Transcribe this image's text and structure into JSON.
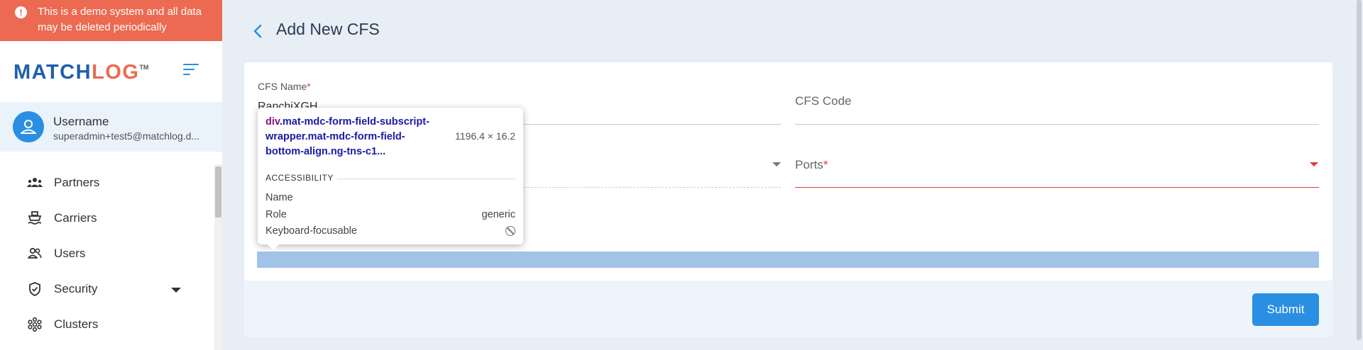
{
  "banner": {
    "text": "This is a demo system and all data may be deleted periodically",
    "icon": "alert-circle-icon"
  },
  "brand": {
    "part1": "MATCH",
    "part2": "LOG",
    "trademark": "TM",
    "color1": "#1f5fa8",
    "color2": "#ec6a51"
  },
  "user": {
    "name": "Username",
    "email": "superadmin+test5@matchlog.d..."
  },
  "nav": {
    "items": [
      {
        "label": "Partners",
        "icon": "partners-icon"
      },
      {
        "label": "Carriers",
        "icon": "ship-icon"
      },
      {
        "label": "Users",
        "icon": "users-icon"
      },
      {
        "label": "Security",
        "icon": "shield-icon",
        "expandable": true
      },
      {
        "label": "Clusters",
        "icon": "clusters-icon"
      }
    ]
  },
  "page": {
    "title": "Add New CFS"
  },
  "form": {
    "cfs_name": {
      "label": "CFS Name",
      "required_mark": "*",
      "value": "RanchiXGH"
    },
    "cfs_code": {
      "placeholder": "CFS Code"
    },
    "ports": {
      "label": "Ports",
      "required_mark": "*"
    },
    "submit_label": "Submit"
  },
  "devtools_tooltip": {
    "selector_tag": "div",
    "selector_rest": ".mat-mdc-form-field-subscript-wrapper.mat-mdc-form-field-bottom-align.ng-tns-c1...",
    "dimensions": "1196.4 × 16.2",
    "section": "ACCESSIBILITY",
    "rows": [
      {
        "key": "Name",
        "value": ""
      },
      {
        "key": "Role",
        "value": "generic"
      },
      {
        "key": "Keyboard-focusable",
        "value": ""
      }
    ]
  },
  "colors": {
    "accent": "#2a8fe3",
    "banner": "#ec6a51",
    "error": "#e53935"
  }
}
